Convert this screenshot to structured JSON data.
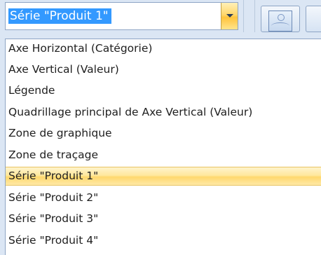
{
  "combo": {
    "value": "Série \"Produit 1\"",
    "button_icon": "chevron-down-icon"
  },
  "ribbon": {
    "picture_icon": "picture-icon"
  },
  "dropdown": {
    "items": [
      "Axe Horizontal (Catégorie)",
      "Axe Vertical (Valeur)",
      "Légende",
      "Quadrillage principal de Axe Vertical (Valeur)",
      "Zone de graphique",
      "Zone de traçage",
      "Série \"Produit 1\"",
      "Série \"Produit 2\"",
      "Série \"Produit 3\"",
      "Série \"Produit 4\""
    ],
    "selected_index": 6
  },
  "colors": {
    "selection_highlight": "#3399ff",
    "hover_item": "#ffe79e"
  }
}
